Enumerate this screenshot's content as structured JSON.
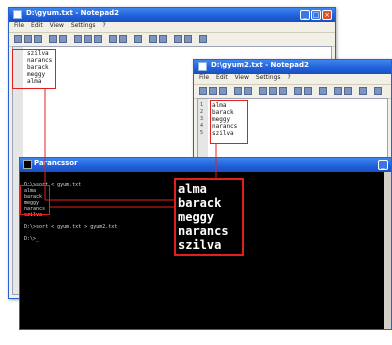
{
  "windows": {
    "notepad1": {
      "title": "D:\\gyum.txt - Notepad2",
      "menu": [
        "File",
        "Edit",
        "View",
        "Settings",
        "?"
      ],
      "lines": [
        "szilva",
        "narancs",
        "barack",
        "meggy",
        "alma"
      ]
    },
    "notepad2": {
      "title": "D:\\gyum2.txt - Notepad2",
      "menu": [
        "File",
        "Edit",
        "View",
        "Settings",
        "?"
      ],
      "lines": [
        "alma",
        "barack",
        "meggy",
        "narancs",
        "szilva"
      ],
      "line_numbers": [
        "1",
        "2",
        "3",
        "4",
        "5"
      ]
    },
    "cmd": {
      "title": "Parancssor",
      "lines": [
        "D:\\>sort < gyum.txt",
        "alma",
        "barack",
        "meggy",
        "narancs",
        "szilva",
        "",
        "D:\\>sort < gyum.txt > gyum2.txt",
        "",
        "D:\\>_"
      ]
    }
  },
  "zoomed_output": [
    "alma",
    "barack",
    "meggy",
    "narancs",
    "szilva"
  ],
  "colors": {
    "titlebar": "#1f5fd8",
    "highlight": "#e02020",
    "console_bg": "#000000"
  }
}
